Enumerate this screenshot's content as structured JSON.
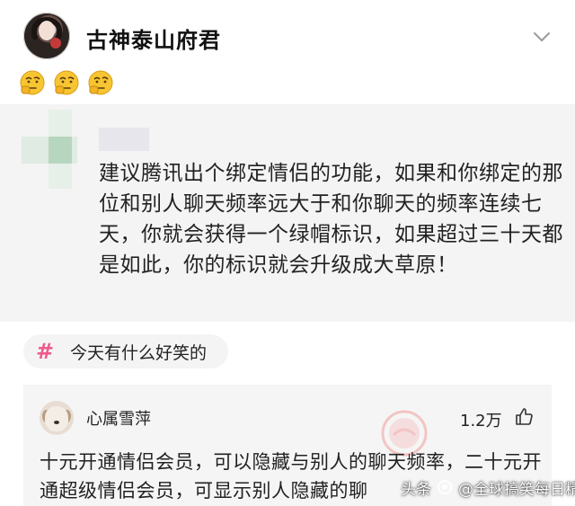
{
  "post": {
    "author_name": "古神泰山府君",
    "emojis": [
      "thinking-face-icon",
      "thinking-face-icon",
      "thinking-face-icon"
    ]
  },
  "quoted_post": {
    "text": "建议腾讯出个绑定情侣的功能，如果和你绑定的那位和别人聊天频率远大于和你聊天的频率连续七天，你就会获得一个绿帽标识，如果超过三十天都是如此，你的标识就会升级成大草原！"
  },
  "topic": {
    "label": "今天有什么好笑的",
    "hash_color": "#ee5a89"
  },
  "comment": {
    "user_name": "心属雪萍",
    "like_count": "1.2万",
    "text": "十元开通情侣会员，可以隐藏与别人的聊天频率，二十元开通超级情侣会员，可显示别人隐藏的聊"
  },
  "watermark": {
    "logo_text": "头条",
    "text": "@全球搞笑每日精选"
  }
}
